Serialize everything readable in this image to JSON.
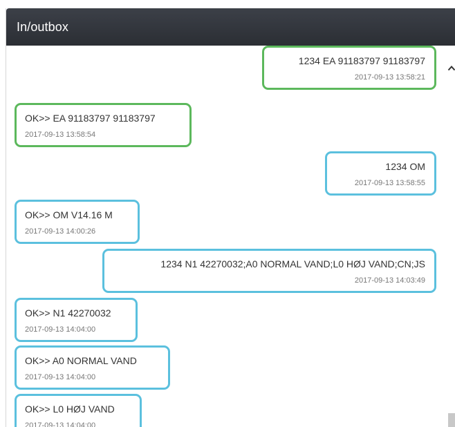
{
  "panel": {
    "title": "In/outbox"
  },
  "messages": [
    {
      "text": "1234 EA 91183797 91183797",
      "time": "2017-09-13 13:58:21"
    },
    {
      "text": "OK>> EA 91183797 91183797",
      "time": "2017-09-13 13:58:54"
    },
    {
      "text": "1234 OM",
      "time": "2017-09-13 13:58:55"
    },
    {
      "text": "OK>> OM V14.16 M",
      "time": "2017-09-13 14:00:26"
    },
    {
      "text": "1234 N1 42270032;A0 NORMAL VAND;L0 HØJ VAND;CN;JS",
      "time": "2017-09-13 14:03:49"
    },
    {
      "text": "OK>> N1 42270032",
      "time": "2017-09-13 14:04:00"
    },
    {
      "text": "OK>> A0 NORMAL VAND",
      "time": "2017-09-13 14:04:00"
    },
    {
      "text": "OK>> L0 HØJ VAND",
      "time": "2017-09-13 14:04:00"
    }
  ],
  "colors": {
    "success_border": "#5cb85c",
    "info_border": "#5bc0de",
    "header_bg": "#2f3238"
  },
  "icons": {
    "scroll_up": "chevron-up-icon"
  }
}
